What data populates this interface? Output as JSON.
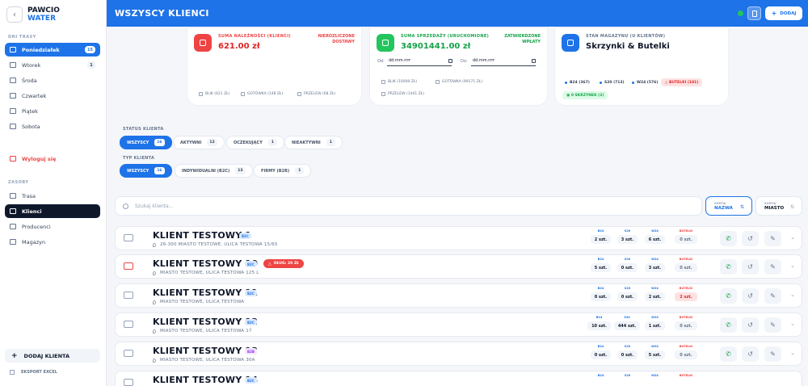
{
  "brand": {
    "line1": "PAWCIO",
    "line2": "WATER",
    "back_icon": "arrow-left-icon"
  },
  "sidebar": {
    "days_title": "DNI TRASY",
    "days": [
      {
        "label": "Poniedziałek",
        "badge": "15",
        "active": true
      },
      {
        "label": "Wtorek",
        "badge": "1"
      },
      {
        "label": "Środa"
      },
      {
        "label": "Czwartek"
      },
      {
        "label": "Piątek"
      },
      {
        "label": "Sobota"
      }
    ],
    "logout": "Wyloguj się",
    "resources_title": "ZASOBY",
    "resources": [
      {
        "label": "Trasa"
      },
      {
        "label": "Klienci",
        "active": true
      },
      {
        "label": "Producenci"
      },
      {
        "label": "Magazyn"
      }
    ],
    "add_client": "DODAJ KLIENTA",
    "export": "EKSPORT EXCEL"
  },
  "header": {
    "title": "WSZYSCY KLIENCI",
    "add_label": "DODAJ",
    "online_color": "#22c55e",
    "accent": "#1e73e8"
  },
  "cards": {
    "receivables": {
      "label": "SUMA NALEŻNOŚCI (KLIENCI)",
      "value": "621.00 zł",
      "right": "NIEROZLICZONE DOSTAWY",
      "blik": "BLIK (621 ZŁ)",
      "cash": "GOTÓWKA (148 ZŁ)",
      "transfer": "PRZELEW (68 ZŁ)"
    },
    "sales": {
      "label": "SUMA SPRZEDAŻY (URUCHOMIONE)",
      "value": "34901441.00 zł",
      "right": "ZATWIERDZONE WPŁATY",
      "from_label": "Od:",
      "to_label": "Do:",
      "from_value": "dd.mm.rrrr",
      "to_value": "dd.mm.rrrr",
      "blik": "BLIK (10000 ZŁ)",
      "cash": "GOTÓWKA (99171 ZŁ)",
      "transfer": "PRZELEW (1441 ZŁ)"
    },
    "stock": {
      "label": "STAN MAGAZYNU (U KLIENTÓW)",
      "value": "Skrzynki & Butelki",
      "items": [
        "B24 (367)",
        "S20 (713)",
        "W24 (576)"
      ],
      "warning": "BUTELKI (181)",
      "crates": "0 SKRZYNEK (2)"
    }
  },
  "filters": {
    "status_title": "STATUS KLIENTA",
    "status": [
      {
        "label": "WSZYSCY",
        "count": "16",
        "active": true
      },
      {
        "label": "AKTYWNI",
        "count": "12"
      },
      {
        "label": "OCZEKUJĄCY",
        "count": "1"
      },
      {
        "label": "NIEAKTYWNI",
        "count": "1"
      }
    ],
    "type_title": "TYP KLIENTA",
    "type": [
      {
        "label": "WSZYSCY",
        "count": "16",
        "active": true
      },
      {
        "label": "INDYWIDUALNI (B2C)",
        "count": "13"
      },
      {
        "label": "FIRMY (B2B)",
        "count": "1"
      }
    ]
  },
  "search": {
    "placeholder": "Szukaj klienta..."
  },
  "sort": [
    {
      "caption": "SORTUJ",
      "value": "NAZWA",
      "icon": "sort-az-icon",
      "active": true
    },
    {
      "caption": "SORTUJ",
      "value": "MIASTO",
      "icon": "sort-icon"
    }
  ],
  "stat_labels": {
    "s1": "B24",
    "s2": "S20",
    "s3": "W24",
    "bottles": "BUTELKI"
  },
  "clients": [
    {
      "name": "KLIENT TESTOWY 1",
      "type": "B2C",
      "address": "26-300 MIASTO TESTOWE, ULICA TESTOWA 15/65",
      "b24": "2 szt.",
      "s20": "3 szt.",
      "w24": "6 szt.",
      "bottles": "0 szt."
    },
    {
      "name": "KLIENT TESTOWY 10",
      "type": "B2C",
      "debt": "DŁUG: 20 ZŁ",
      "address": "MIASTO TESTOWE, ULICA TESTOWA 125 L",
      "b24": "5 szt.",
      "s20": "0 szt.",
      "w24": "3 szt.",
      "bottles": "0 szt."
    },
    {
      "name": "KLIENT TESTOWY 11",
      "type": "B2C",
      "address": "MIASTO TESTOWE, ULICA TESTOWA",
      "b24": "0 szt.",
      "s20": "0 szt.",
      "w24": "2 szt.",
      "bottles": "2 szt.",
      "bottles_alert": true
    },
    {
      "name": "KLIENT TESTOWY 12",
      "type": "B2C",
      "address": "MIASTO TESTOWE, ULICA TESTOWA 17",
      "b24": "10 szt.",
      "s20": "444 szt.",
      "w24": "1 szt.",
      "bottles": "0 szt."
    },
    {
      "name": "KLIENT TESTOWY 13",
      "type": "B2B",
      "address": "MIASTO TESTOWE, ULICA TESTOWA 30A",
      "b24": "0 szt.",
      "s20": "0 szt.",
      "w24": "5 szt.",
      "bottles": "0 szt."
    },
    {
      "name": "KLIENT TESTOWY 14",
      "type": "B2C",
      "address": "",
      "b24": "",
      "s20": "",
      "w24": "",
      "bottles": ""
    }
  ]
}
